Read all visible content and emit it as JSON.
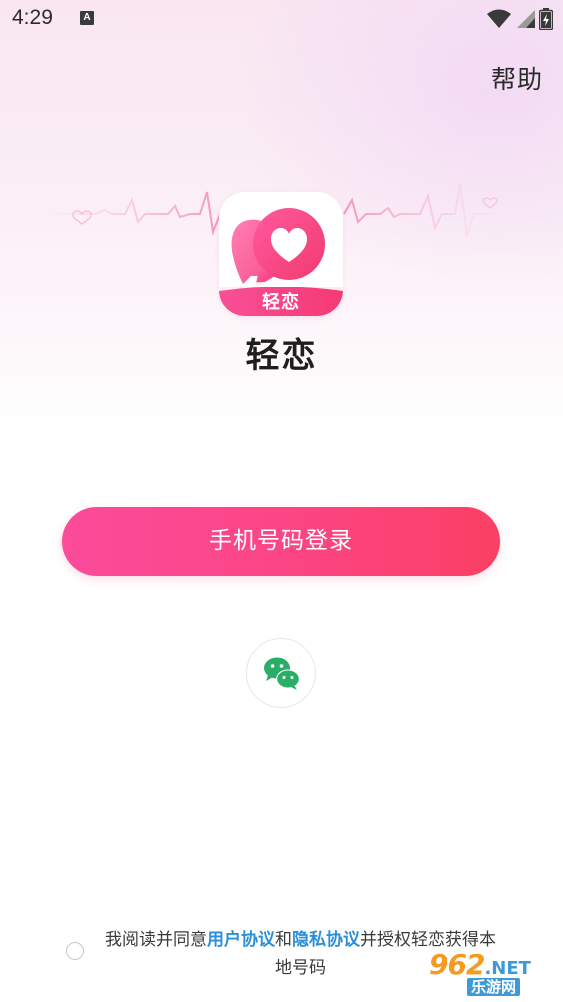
{
  "status_bar": {
    "time": "4:29",
    "notification_icon_letter": "A",
    "icons": [
      "wifi-icon",
      "signal-icon",
      "battery-icon"
    ]
  },
  "header": {
    "help_label": "帮助"
  },
  "app": {
    "logo_badge": "轻恋",
    "name": "轻恋"
  },
  "login": {
    "phone_button_label": "手机号码登录",
    "wechat_icon": "wechat-icon"
  },
  "agreement": {
    "checked": false,
    "prefix": "我阅读并同意",
    "user_agreement_link": "用户协议",
    "conjunction": "和",
    "privacy_link": "隐私协议",
    "suffix": "并授权轻恋获得本地号码"
  },
  "watermark": {
    "brand": "962",
    "domain": ".NET",
    "site_name": "乐游网"
  },
  "colors": {
    "primary_gradient_start": "#fb4b9a",
    "primary_gradient_end": "#fb3f63",
    "link": "#2b8fd9",
    "wechat": "#2aae67"
  }
}
